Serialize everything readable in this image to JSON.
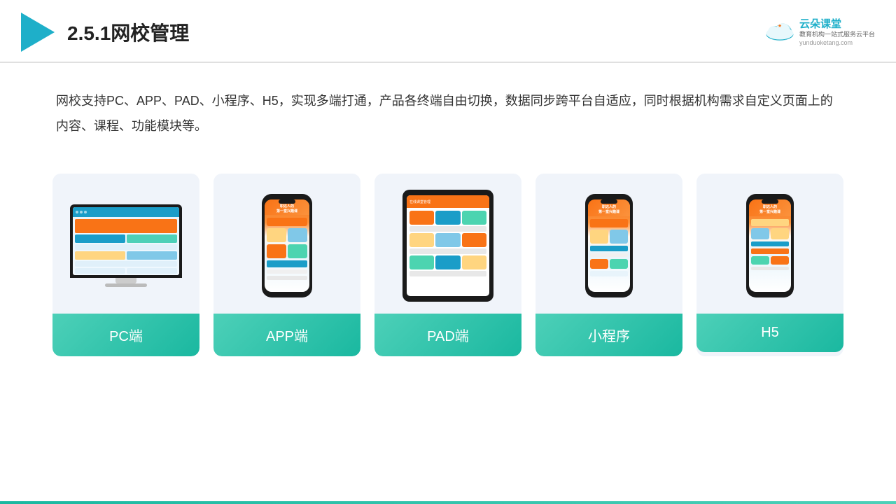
{
  "header": {
    "title": "2.5.1网校管理",
    "brand": {
      "name": "云朵课堂",
      "url": "yunduoketang.com",
      "tagline": "教育机构一站\n式服务云平台"
    }
  },
  "description": {
    "text": "网校支持PC、APP、PAD、小程序、H5，实现多端打通，产品各终端自由切换，数据同步跨平台自适应，同时根据机构需求自定义页面上的内容、课程、功能模块等。"
  },
  "cards": [
    {
      "id": "pc",
      "label": "PC端"
    },
    {
      "id": "app",
      "label": "APP端"
    },
    {
      "id": "pad",
      "label": "PAD端"
    },
    {
      "id": "miniprogram",
      "label": "小程序"
    },
    {
      "id": "h5",
      "label": "H5"
    }
  ],
  "colors": {
    "teal": "#4dd0b8",
    "accent": "#1ab8a0",
    "header_border": "#e0e0e0"
  }
}
